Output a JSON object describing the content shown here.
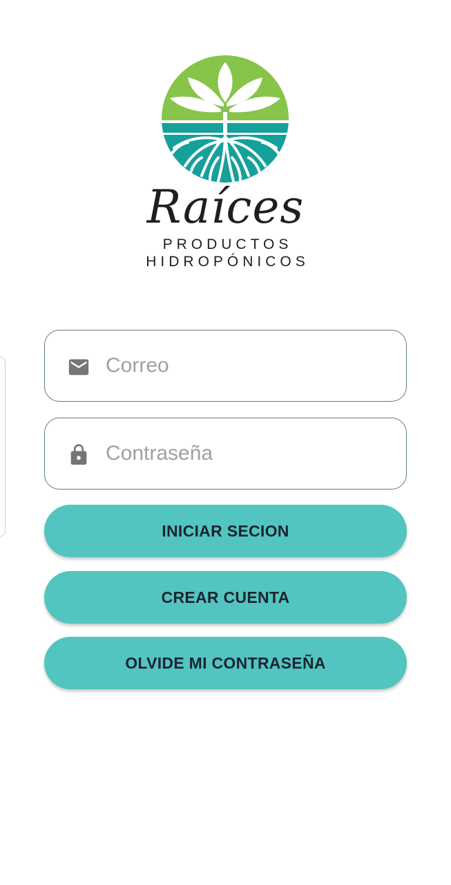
{
  "logo": {
    "script_text": "Raíces",
    "line1": "PRODUCTOS",
    "line2": "HIDROPÓNICOS",
    "colors": {
      "green": "#86c44a",
      "teal": "#16a09b"
    }
  },
  "form": {
    "email": {
      "icon": "mail-icon",
      "placeholder": "Correo",
      "value": ""
    },
    "password": {
      "icon": "lock-icon",
      "placeholder": "Contraseña",
      "value": ""
    }
  },
  "buttons": {
    "login_label": "INICIAR SECION",
    "create_label": "CREAR CUENTA",
    "forgot_label": "OLVIDE MI CONTRASEÑA"
  },
  "theme": {
    "accent": "#52c5c0",
    "field_border": "#5e7a86",
    "icon_color": "#757575"
  }
}
